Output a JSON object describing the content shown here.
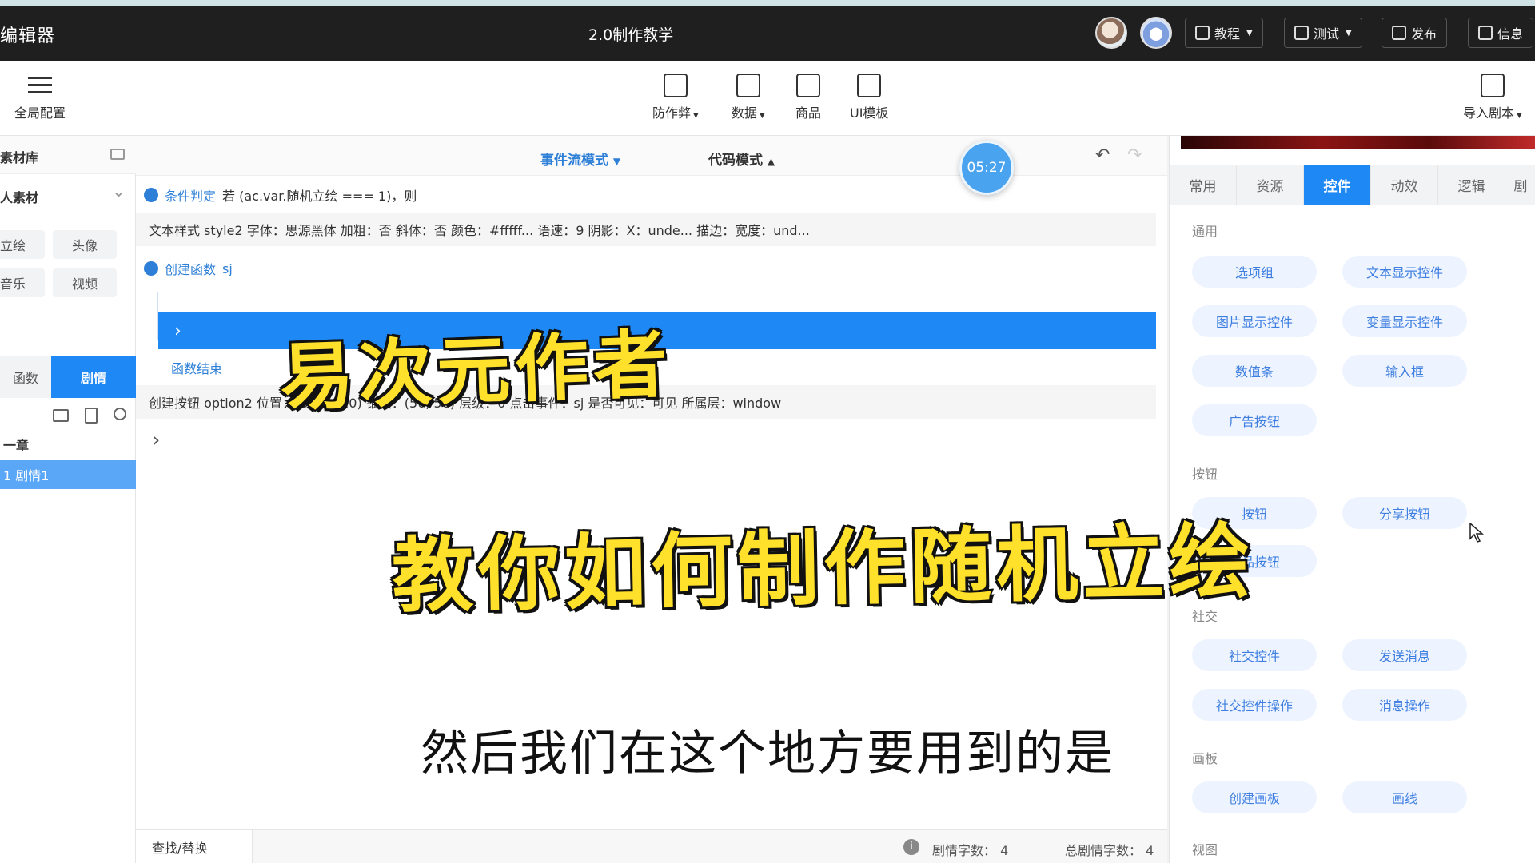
{
  "header": {
    "app_title": "编辑器",
    "project_title": "2.0制作教学",
    "buttons": [
      {
        "label": "教程",
        "icon": "book-icon"
      },
      {
        "label": "测试",
        "icon": "play-icon"
      },
      {
        "label": "发布",
        "icon": "export-icon"
      },
      {
        "label": "信息",
        "icon": "edit-icon"
      }
    ]
  },
  "toolbar": {
    "left": {
      "label": "全局配置",
      "icon": "list-icon"
    },
    "center": [
      {
        "label": "防作弊",
        "icon": "anti-cheat-icon",
        "caret": true
      },
      {
        "label": "数据",
        "icon": "chart-icon",
        "caret": true
      },
      {
        "label": "商品",
        "icon": "shopping-bag-icon",
        "caret": false
      },
      {
        "label": "UI模板",
        "icon": "template-icon",
        "caret": false
      }
    ],
    "right": {
      "label": "导入剧本",
      "icon": "import-icon"
    }
  },
  "left_panel": {
    "library_title": "素材库",
    "my_assets": "人素材",
    "chips": [
      "立绘",
      "头像",
      "音乐",
      "视频"
    ],
    "tabs": [
      "函数",
      "剧情"
    ],
    "chapter": "一章",
    "story_item": "1  剧情1"
  },
  "editor": {
    "mode_event": "事件流模式",
    "mode_code": "代码模式",
    "timer": "05:27",
    "cond_label": "条件判定",
    "cond_text": "若 (ac.var.随机立绘 === 1)，则",
    "style_row": "文本样式   style2   字体：思源黑体   加粗：否   斜体：否   颜色：#fffff...   语速：9   阴影：X：unde...   描边：宽度：und...",
    "func_label": "创建函数",
    "func_name": "sj",
    "func_end": "函数结束",
    "button_row": "创建按钮   option2   位置：(646, 120)   锚点：(50, 50)   层级：0   点击事件：sj   是否可见：可见   所属层：window"
  },
  "status": {
    "find": "查找/替换",
    "story_count": "剧情字数：  4",
    "total_count": "总剧情字数：  4"
  },
  "right_panel": {
    "tabs": [
      "常用",
      "资源",
      "控件",
      "动效",
      "逻辑",
      "剧"
    ],
    "active_tab": "控件",
    "sections": {
      "general": "通用",
      "buttons": "按钮",
      "social": "社交",
      "canvas": "画板",
      "view": "视图"
    },
    "general_items": [
      "选项组",
      "文本显示控件",
      "图片显示控件",
      "变量显示控件",
      "数值条",
      "输入框",
      "广告按钮"
    ],
    "button_items": [
      "按钮",
      "分享按钮",
      "商品按钮"
    ],
    "social_items": [
      "社交控件",
      "发送消息",
      "社交控件操作",
      "消息操作"
    ],
    "canvas_items": [
      "创建画板",
      "画线"
    ]
  },
  "overlay": {
    "title_1": "易次元作者",
    "title_2": "教你如何制作随机立绘",
    "subtitle": "然后我们在这个地方要用到的是"
  },
  "colors": {
    "accent": "#1e88f5",
    "header_bg": "#1f1f1f",
    "overlay_text": "#ffe02a"
  }
}
